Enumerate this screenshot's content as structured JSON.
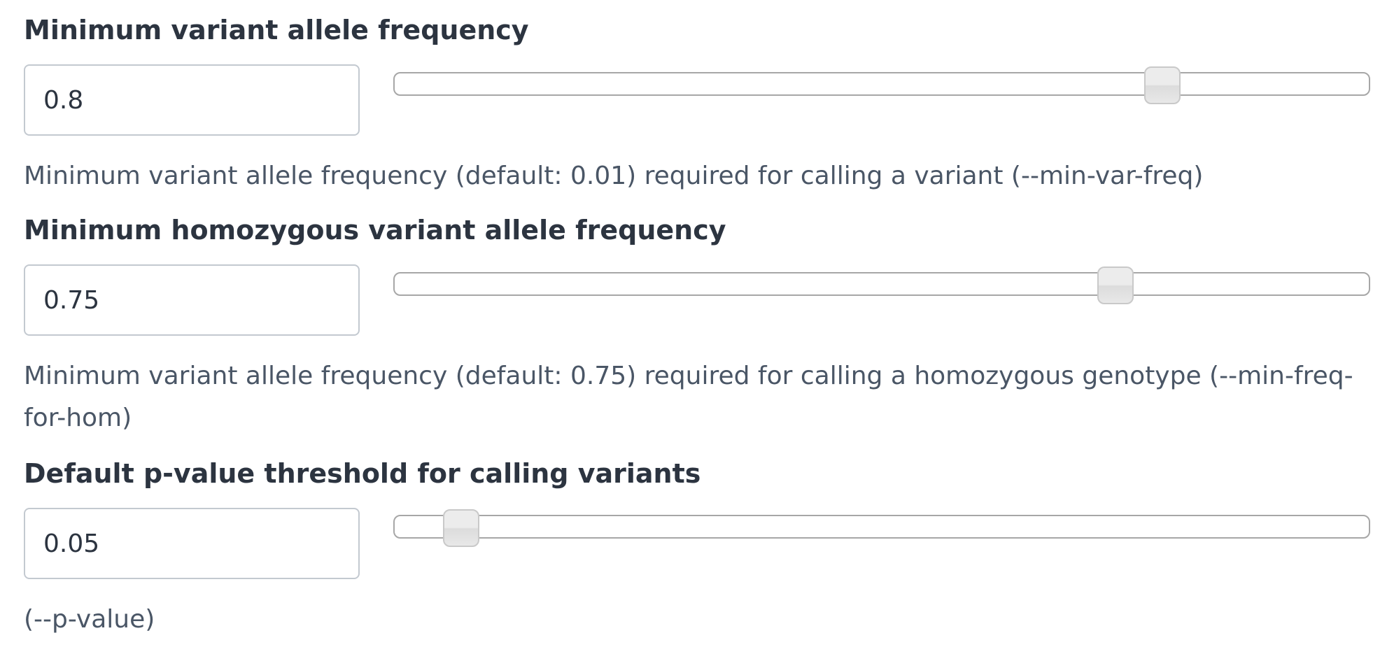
{
  "params": [
    {
      "label": "Minimum variant allele frequency",
      "value": "0.8",
      "slider_fraction": 0.8,
      "help": "Minimum variant allele frequency (default: 0.01) required for calling a variant (--min-var-freq)"
    },
    {
      "label": "Minimum homozygous variant allele frequency",
      "value": "0.75",
      "slider_fraction": 0.75,
      "help": "Minimum variant allele frequency (default: 0.75) required for calling a homozygous genotype (--min-freq-for-hom)"
    },
    {
      "label": "Default p-value threshold for calling variants",
      "value": "0.05",
      "slider_fraction": 0.05,
      "help": "(--p-value)"
    }
  ],
  "colors": {
    "label": "#2c3440",
    "help": "#4a5666",
    "input_border": "#c3c9d0",
    "track_border": "#a7a7a7",
    "handle": "#ececec"
  }
}
